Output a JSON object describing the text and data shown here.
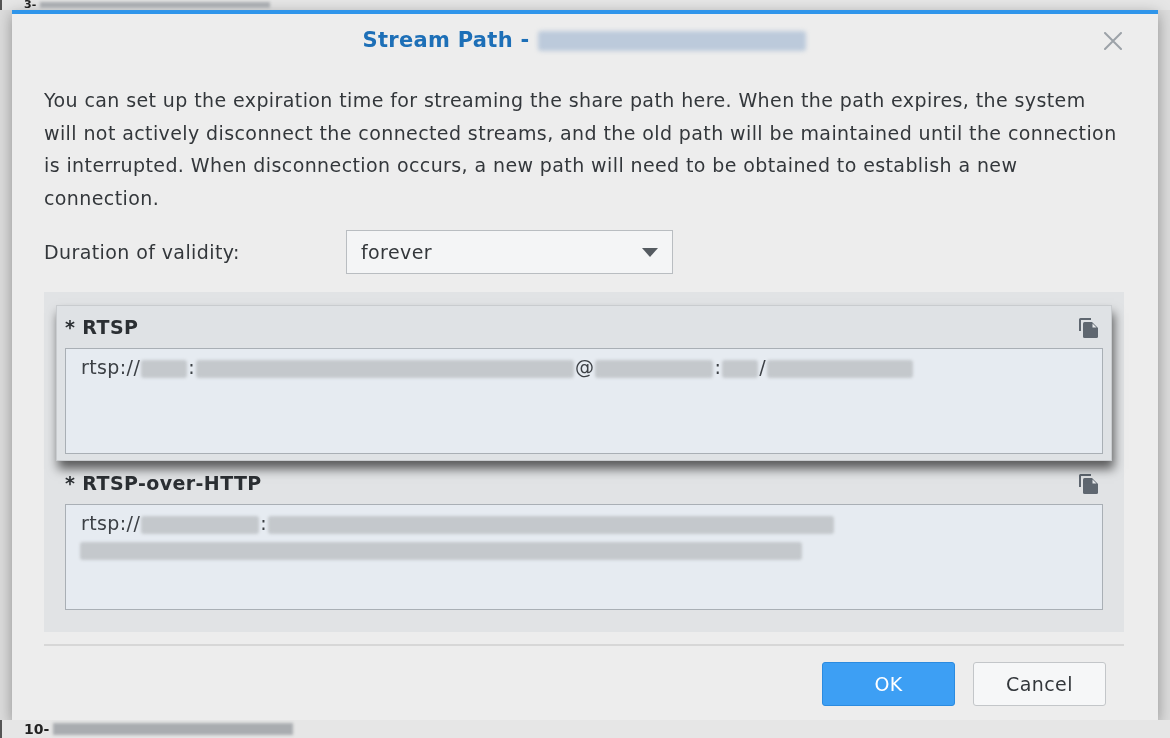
{
  "background_list": {
    "rows": [
      {
        "label": "3-"
      },
      {
        "label": "10-"
      }
    ]
  },
  "dialog": {
    "title": "Stream Path -",
    "title_suffix_blurred": true,
    "description": "You can set up the expiration time for streaming the share path here. When the path expires, the system will not actively disconnect the connected streams, and the old path will be maintained until the connection is interrupted. When disconnection occurs, a new path will need to be obtained to establish a new connection.",
    "duration": {
      "label": "Duration of validity:",
      "value": "forever"
    },
    "paths": [
      {
        "label": "* RTSP",
        "highlighted": true,
        "url_parts": [
          {
            "kind": "text",
            "text": "rtsp://"
          },
          {
            "kind": "blurred"
          },
          {
            "kind": "text",
            "text": ":"
          },
          {
            "kind": "blurred"
          },
          {
            "kind": "text",
            "text": "@"
          },
          {
            "kind": "blurred"
          },
          {
            "kind": "text",
            "text": ":"
          },
          {
            "kind": "blurred"
          },
          {
            "kind": "text",
            "text": "/"
          },
          {
            "kind": "blurred"
          }
        ]
      },
      {
        "label": "* RTSP-over-HTTP",
        "highlighted": false,
        "url_parts": [
          {
            "kind": "text",
            "text": "rtsp://"
          },
          {
            "kind": "blurred"
          },
          {
            "kind": "text",
            "text": ":"
          },
          {
            "kind": "blurred"
          },
          {
            "kind": "blurred"
          }
        ]
      }
    ],
    "buttons": [
      {
        "label": "OK",
        "kind": "primary"
      },
      {
        "label": "Cancel",
        "kind": "secondary"
      }
    ]
  }
}
